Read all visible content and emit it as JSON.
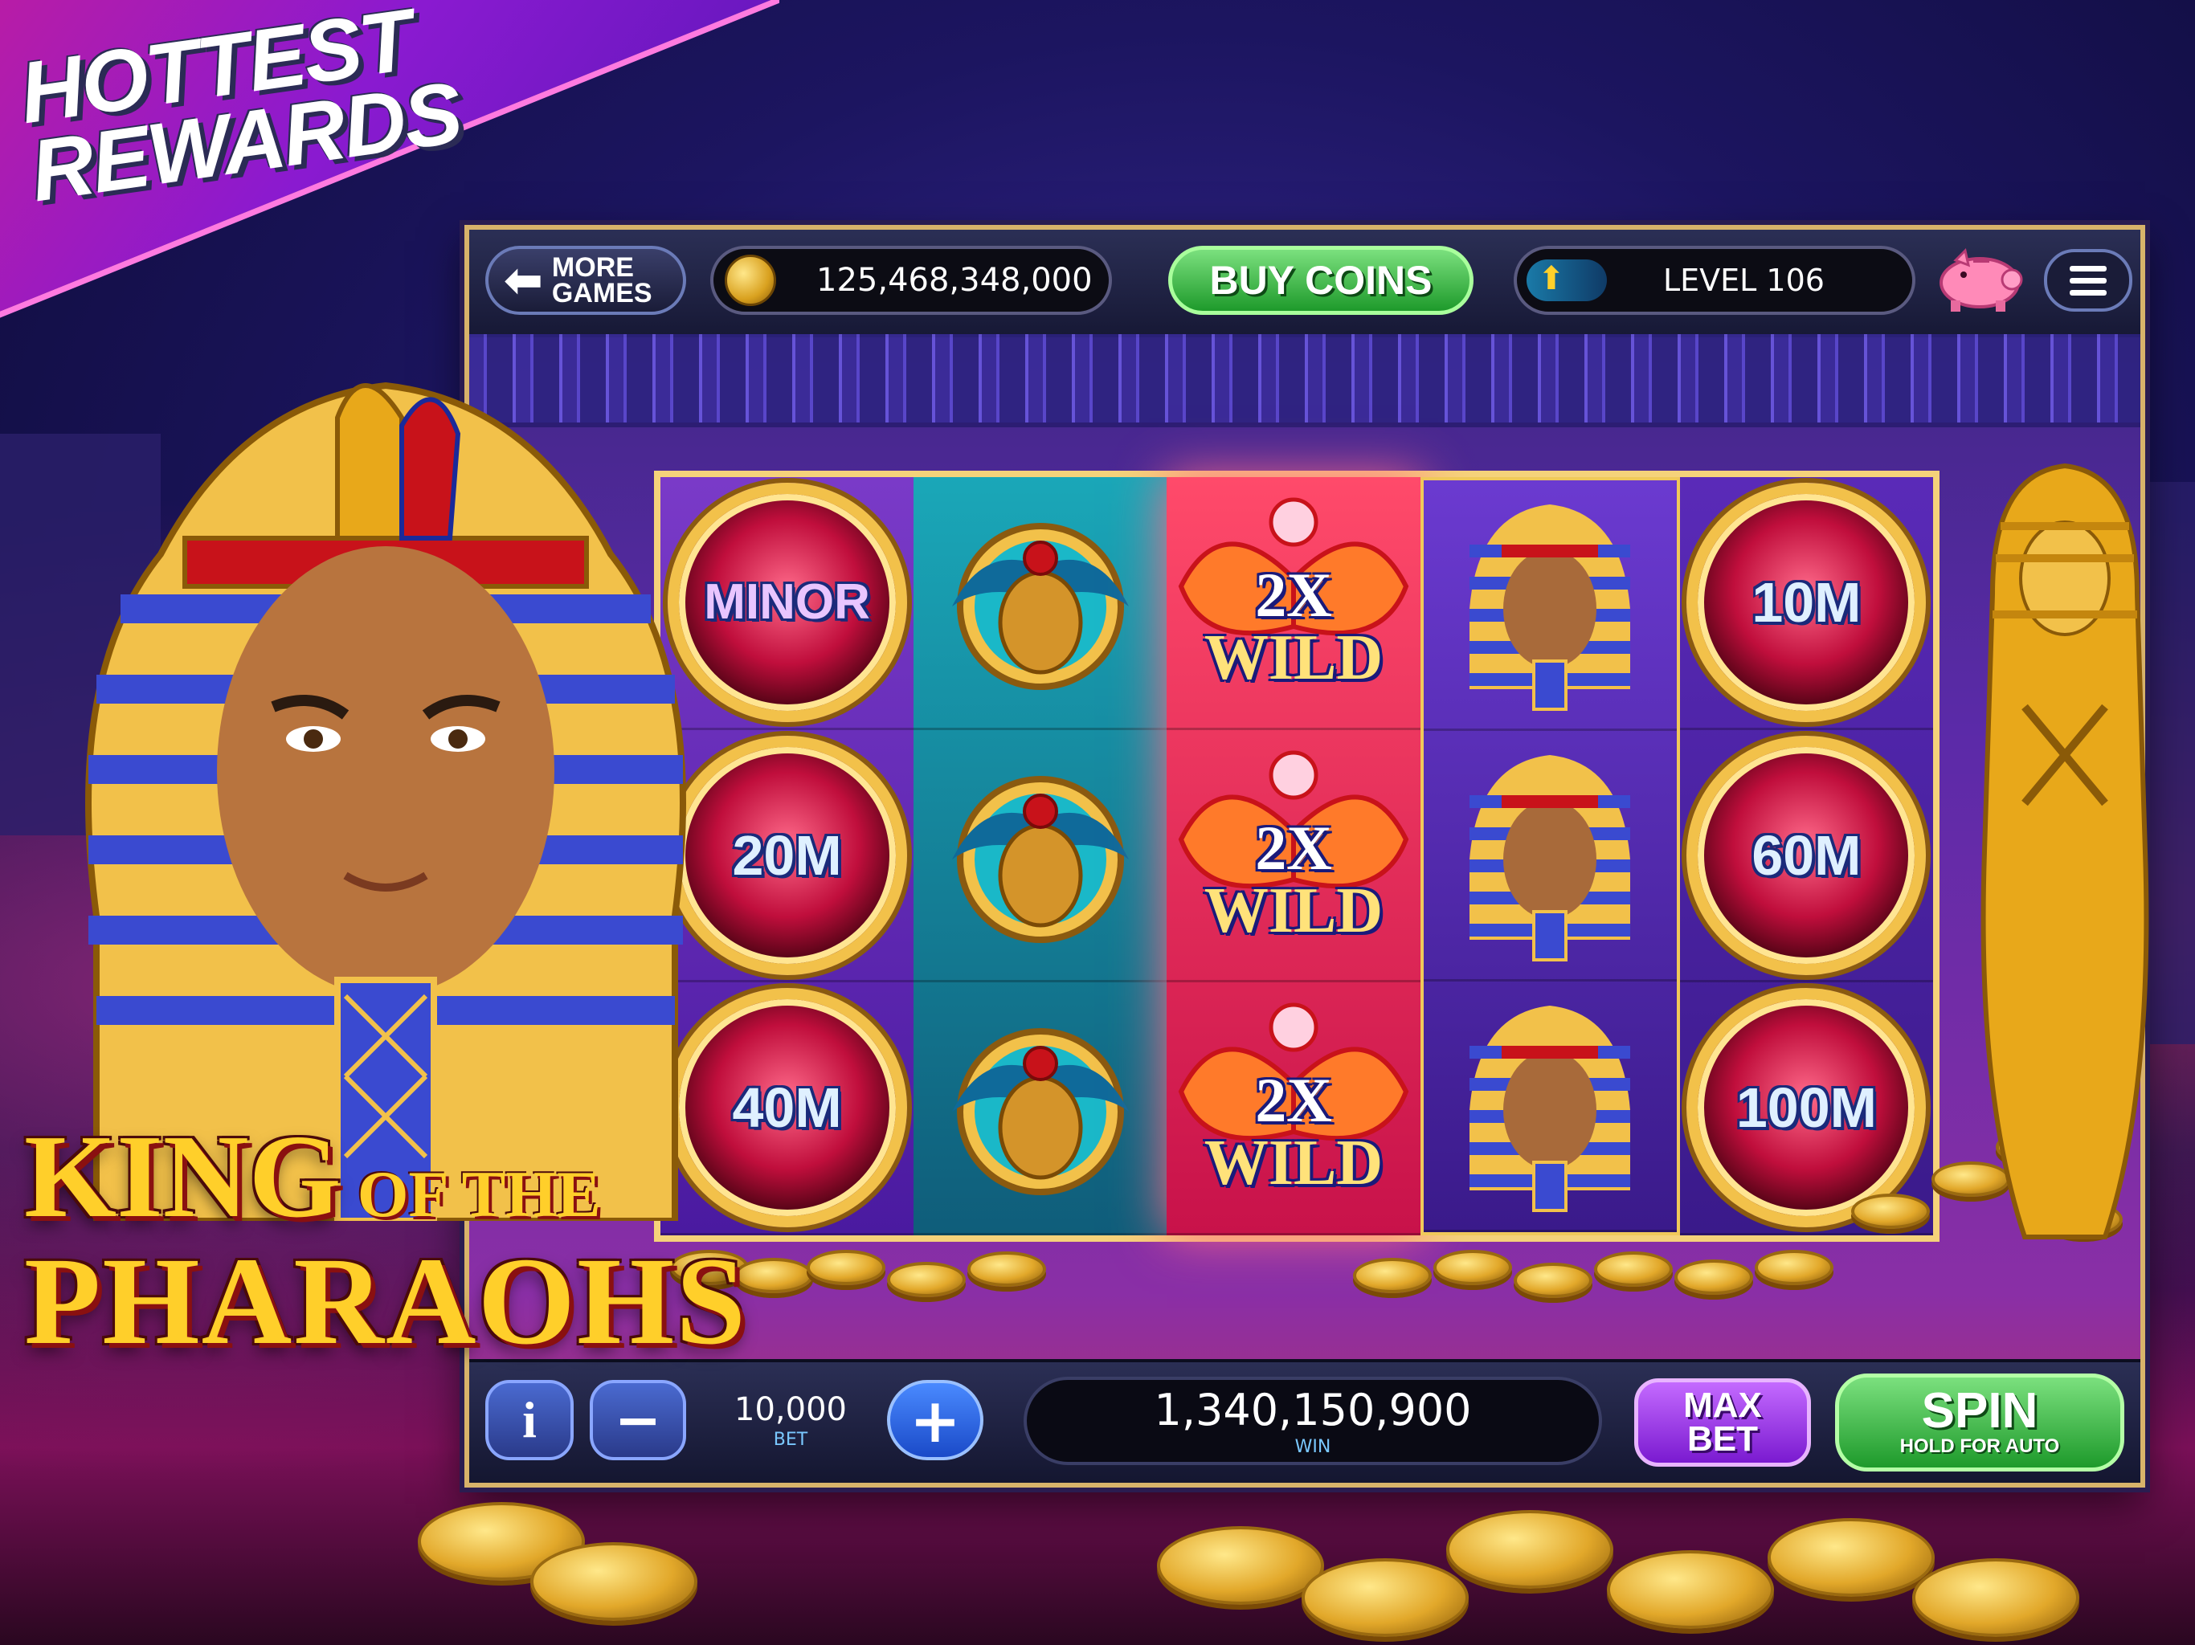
{
  "promo": {
    "title_line1": "HOTTEST",
    "title_line2": "REWARDS"
  },
  "top_bar": {
    "more_games_line1": "MORE",
    "more_games_line2": "GAMES",
    "coin_balance": "125,468,348,000",
    "buy_coins_label": "BUY COINS",
    "level_label": "LEVEL 106"
  },
  "reels": [
    {
      "symbols": [
        {
          "type": "coin",
          "label": "MINOR"
        },
        {
          "type": "coin",
          "label": "20M"
        },
        {
          "type": "coin",
          "label": "40M"
        }
      ]
    },
    {
      "symbols": [
        {
          "type": "scarab"
        },
        {
          "type": "scarab"
        },
        {
          "type": "scarab"
        }
      ]
    },
    {
      "symbols": [
        {
          "type": "wild",
          "line1": "2X",
          "line2": "WILD"
        },
        {
          "type": "wild",
          "line1": "2X",
          "line2": "WILD"
        },
        {
          "type": "wild",
          "line1": "2X",
          "line2": "WILD"
        }
      ]
    },
    {
      "symbols": [
        {
          "type": "pharaoh"
        },
        {
          "type": "pharaoh"
        },
        {
          "type": "pharaoh"
        }
      ]
    },
    {
      "symbols": [
        {
          "type": "coin",
          "label": "10M"
        },
        {
          "type": "coin",
          "label": "60M"
        },
        {
          "type": "coin",
          "label": "100M"
        }
      ]
    }
  ],
  "game_logo": {
    "line1_big": "KING",
    "line1_small": "OF THE",
    "line2": "PHARAOHS"
  },
  "bottom_bar": {
    "info_label": "i",
    "minus_label": "−",
    "bet_value": "10,000",
    "bet_label": "BET",
    "plus_label": "+",
    "win_value": "1,340,150,900",
    "win_label": "WIN",
    "max_bet_line1": "MAX",
    "max_bet_line2": "BET",
    "spin_label": "SPIN",
    "spin_sub": "HOLD FOR AUTO"
  },
  "colors": {
    "buy_coins": "#1e9a2b",
    "spin": "#1e9a2b",
    "max_bet": "#7a1ad0",
    "frame_gold": "#f5d27a"
  }
}
